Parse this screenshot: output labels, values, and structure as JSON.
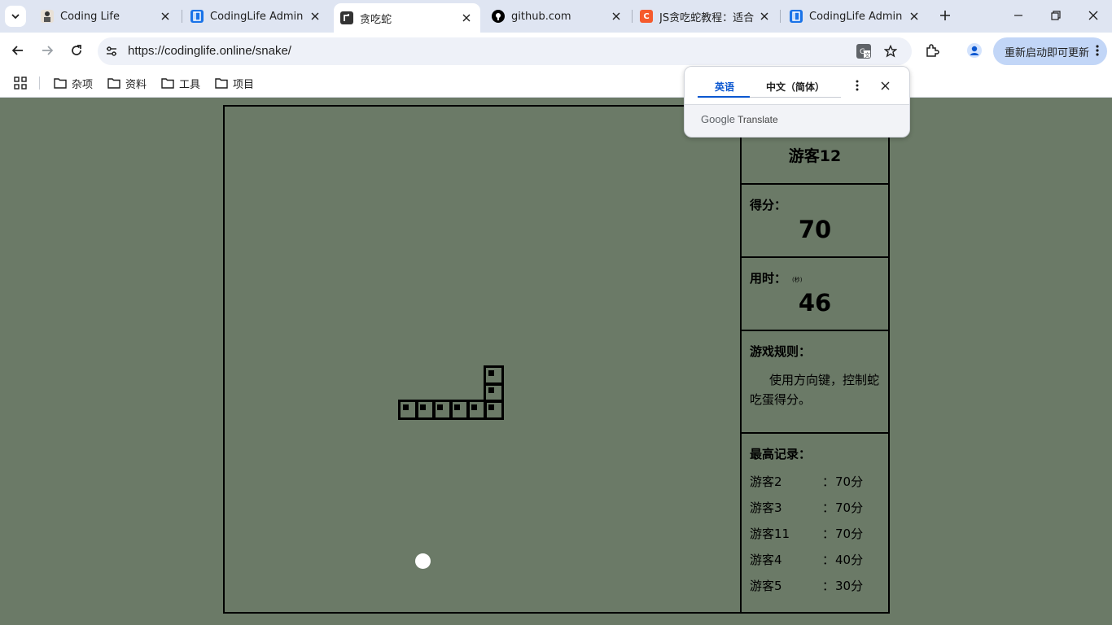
{
  "browser": {
    "tabs": [
      {
        "title": "Coding Life",
        "favicon": "CL",
        "favicon_color": "#e8e0d6"
      },
      {
        "title": "CodingLife Admin",
        "favicon": "",
        "favicon_color": "#1a73e8"
      },
      {
        "title": "贪吃蛇",
        "favicon": "",
        "favicon_color": "#333333"
      },
      {
        "title": "github.com",
        "favicon": "",
        "favicon_color": "#000000"
      },
      {
        "title": "JS贪吃蛇教程：适合",
        "favicon": "C",
        "favicon_color": "#f55a2c"
      },
      {
        "title": "CodingLife Admin",
        "favicon": "",
        "favicon_color": "#1a73e8"
      }
    ],
    "active_tab_index": 2,
    "url": "https://codinglife.online/snake/",
    "update_button": "重新启动即可更新",
    "bookmarks": [
      "杂项",
      "资料",
      "工具",
      "项目"
    ]
  },
  "translate_popup": {
    "source_lang": "英语",
    "target_lang": "中文（简体）",
    "brand_google": "Google",
    "brand_translate": "Translate"
  },
  "game": {
    "player": "游客12",
    "score_label": "得分：",
    "score": "70",
    "time_label": "用时：",
    "time_unit": "(秒)",
    "time": "46",
    "rules_label": "游戏规则：",
    "rules_text": "使用方向键，控制蛇吃蛋得分。",
    "records_label": "最高记录：",
    "records": [
      {
        "name": "游客2",
        "sep": "：",
        "score": "70分"
      },
      {
        "name": "游客3",
        "sep": "：",
        "score": "70分"
      },
      {
        "name": "游客11",
        "sep": "：",
        "score": "70分"
      },
      {
        "name": "游客4",
        "sep": "：",
        "score": "40分"
      },
      {
        "name": "游客5",
        "sep": "：",
        "score": "30分"
      }
    ],
    "snake_cells": [
      [
        10,
        17
      ],
      [
        11,
        17
      ],
      [
        12,
        17
      ],
      [
        13,
        17
      ],
      [
        14,
        17
      ],
      [
        15,
        17
      ],
      [
        15,
        16
      ],
      [
        15,
        15
      ]
    ],
    "food_cell": [
      11,
      26
    ]
  }
}
